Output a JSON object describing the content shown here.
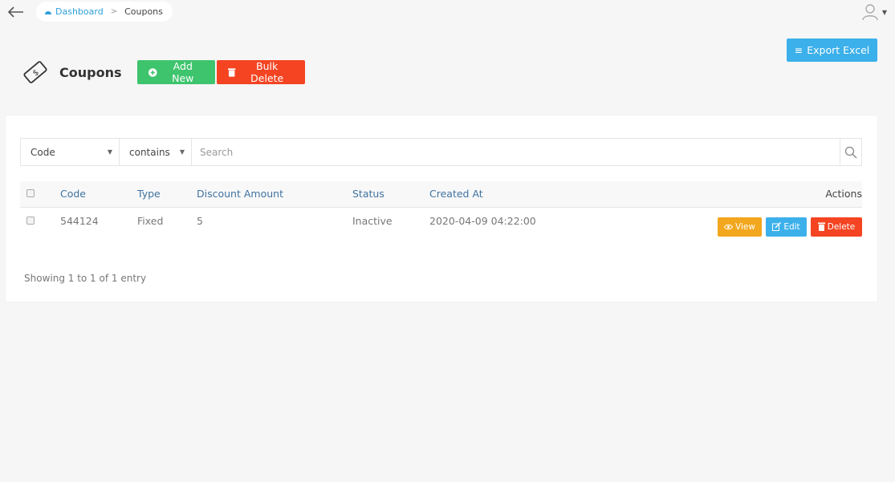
{
  "breadcrumb": {
    "home": "Dashboard",
    "current": "Coupons"
  },
  "header": {
    "title": "Coupons",
    "add_label": "Add New",
    "bulk_delete_label": "Bulk Delete",
    "export_label": "Export Excel"
  },
  "filter": {
    "field": "Code",
    "operator": "contains",
    "search_placeholder": "Search"
  },
  "table": {
    "columns": [
      "Code",
      "Type",
      "Discount Amount",
      "Status",
      "Created At",
      "Actions"
    ],
    "rows": [
      {
        "code": "544124",
        "type": "Fixed",
        "discount": "5",
        "status": "Inactive",
        "created_at": "2020-04-09 04:22:00"
      }
    ],
    "actions": {
      "view": "View",
      "edit": "Edit",
      "delete": "Delete"
    }
  },
  "pagination": {
    "info": "Showing 1 to 1 of 1 entry"
  },
  "colors": {
    "green": "#3ec46d",
    "red": "#f44422",
    "blue": "#3cb0ea",
    "orange": "#f2a71e",
    "link": "#2e9fd8"
  }
}
